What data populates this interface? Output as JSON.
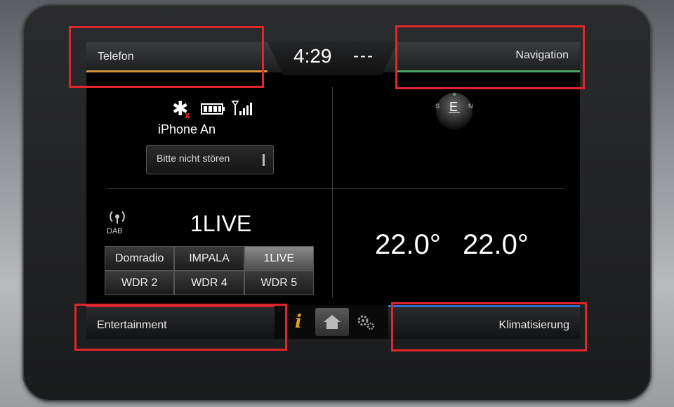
{
  "header": {
    "phone_tab": "Telefon",
    "time": "4:29",
    "time_suffix": "---",
    "navigation_tab": "Navigation"
  },
  "phone": {
    "device_status": "iPhone An",
    "dnd_button": "Bitte nicht stören"
  },
  "navigation": {
    "compass_heading": "E",
    "compass_left": "S",
    "compass_right": "N"
  },
  "radio": {
    "source": "DAB",
    "current_station": "1LIVE",
    "presets": [
      "Domradio",
      "IMPALA",
      "1LIVE",
      "WDR 2",
      "WDR 4",
      "WDR 5"
    ],
    "active_preset": "1LIVE"
  },
  "climate": {
    "left_temp": "22.0°",
    "right_temp": "22.0°"
  },
  "footer": {
    "entertainment_tab": "Entertainment",
    "climate_tab": "Klimatisierung"
  },
  "colors": {
    "phone_accent": "#d2923a",
    "nav_accent": "#4aa36a",
    "entertainment_accent": "#c1272d",
    "climate_accent": "#2f6fc7",
    "annotation": "#e0262c"
  }
}
